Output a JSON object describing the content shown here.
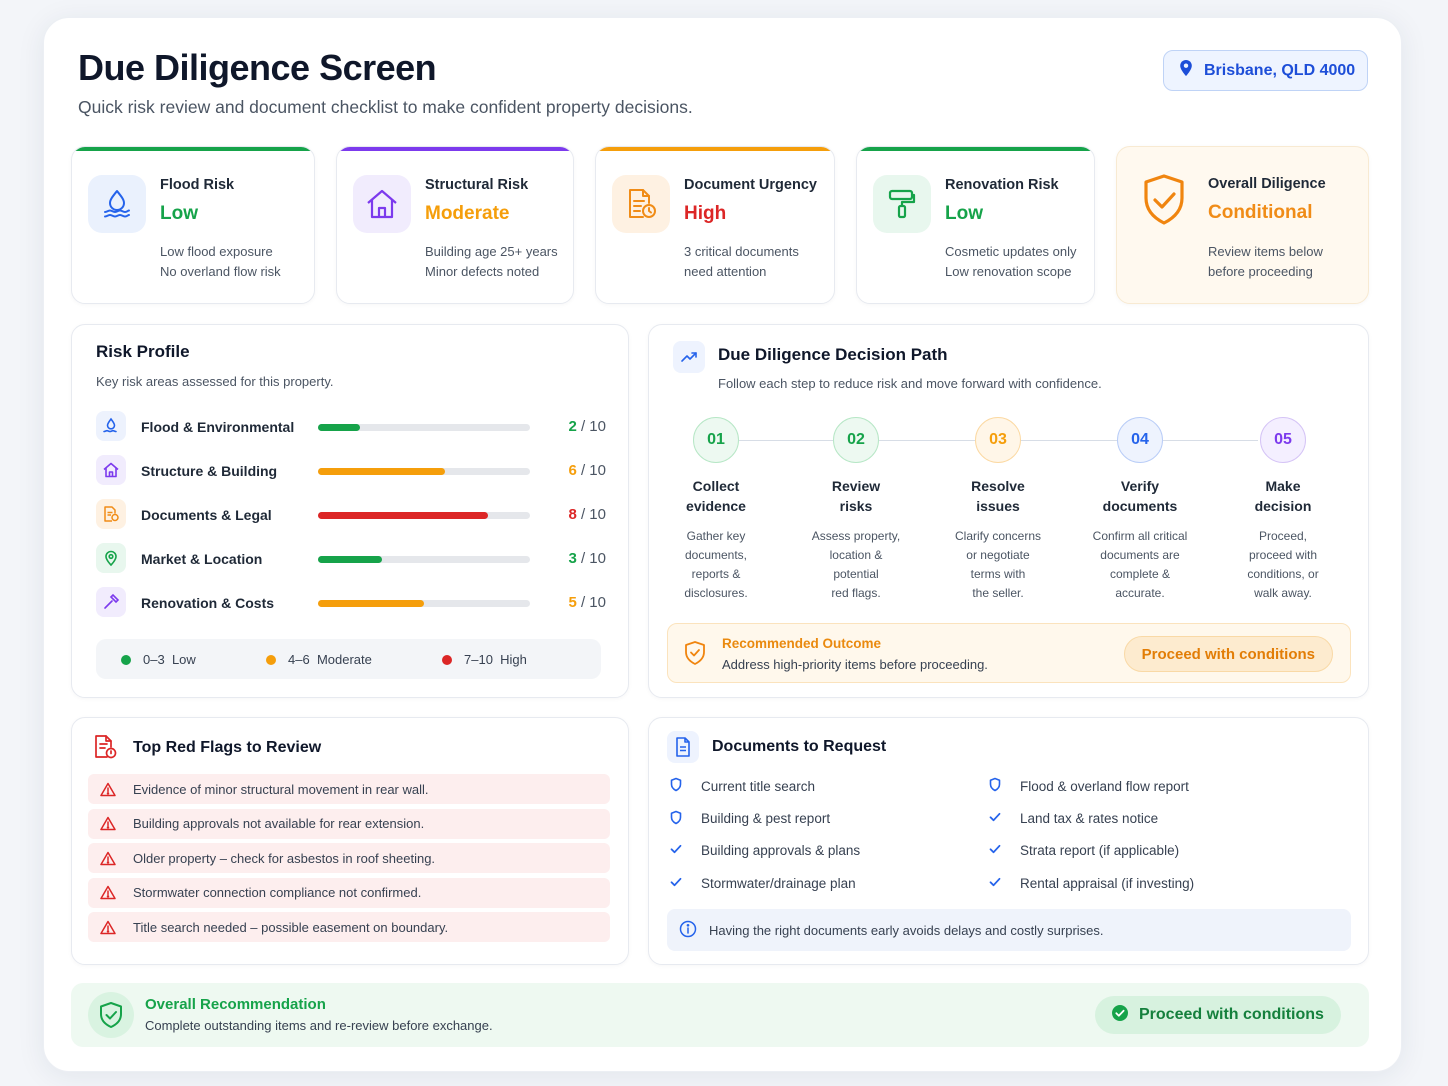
{
  "header": {
    "title": "Due Diligence Screen",
    "subtitle": "Quick risk review and document checklist to make confident property decisions.",
    "location": "Brisbane, QLD 4000"
  },
  "risk_cards": [
    {
      "label": "Flood Risk",
      "value": "Low",
      "d1": "Low flood exposure",
      "d2": "No overland flow risk",
      "color": "#16a34a",
      "icon": "water-drop-icon"
    },
    {
      "label": "Structural Risk",
      "value": "Moderate",
      "d1": "Building age 25+ years",
      "d2": "Minor defects noted",
      "color": "#f59e0b",
      "icon": "house-icon"
    },
    {
      "label": "Document Urgency",
      "value": "High",
      "d1": "3 critical documents",
      "d2": "need attention",
      "color": "#dc2626",
      "icon": "document-clock-icon"
    },
    {
      "label": "Renovation Risk",
      "value": "Low",
      "d1": "Cosmetic updates only",
      "d2": "Low renovation scope",
      "color": "#16a34a",
      "icon": "paint-roller-icon"
    },
    {
      "label": "Overall Diligence",
      "value": "Conditional",
      "d1": "Review items below",
      "d2": "before proceeding",
      "color": "#f59e0b",
      "icon": "shield-check-icon"
    }
  ],
  "risk_profile": {
    "title": "Risk Profile",
    "subtitle": "Key risk areas assessed for this property.",
    "rows": [
      {
        "label": "Flood & Environmental",
        "score": "2",
        "max": "/ 10",
        "level": 0.2,
        "color": "#16a34a",
        "icon": "water-drop-icon"
      },
      {
        "label": "Structure & Building",
        "score": "6",
        "max": "/ 10",
        "level": 0.6,
        "color": "#f59e0b",
        "icon": "house-icon"
      },
      {
        "label": "Documents & Legal",
        "score": "8",
        "max": "/ 10",
        "level": 0.8,
        "color": "#dc2626",
        "icon": "document-clock-icon"
      },
      {
        "label": "Market & Location",
        "score": "3",
        "max": "/ 10",
        "level": 0.3,
        "color": "#16a34a",
        "icon": "map-pin-icon"
      },
      {
        "label": "Renovation & Costs",
        "score": "5",
        "max": "/ 10",
        "level": 0.5,
        "color": "#f59e0b",
        "icon": "hammer-icon"
      }
    ],
    "legend": [
      {
        "range": "0–3",
        "label": "Low",
        "color": "#16a34a"
      },
      {
        "range": "4–6",
        "label": "Moderate",
        "color": "#f59e0b"
      },
      {
        "range": "7–10",
        "label": "High",
        "color": "#dc2626"
      }
    ]
  },
  "decision_path": {
    "title": "Due Diligence Decision Path",
    "subtitle": "Follow each step to reduce risk and move forward with confidence.",
    "steps": [
      {
        "num": "01",
        "t1": "Collect",
        "t2": "evidence",
        "desc": [
          "Gather key",
          "documents,",
          "reports &",
          "disclosures."
        ],
        "color": "#16a34a",
        "bg": "#edf9f1",
        "border": "#b7e7c6"
      },
      {
        "num": "02",
        "t1": "Review",
        "t2": "risks",
        "desc": [
          "Assess property,",
          "location &",
          "potential",
          "red flags."
        ],
        "color": "#16a34a",
        "bg": "#edf9f1",
        "border": "#b7e7c6"
      },
      {
        "num": "03",
        "t1": "Resolve",
        "t2": "issues",
        "desc": [
          "Clarify concerns",
          "or negotiate",
          "terms with",
          "the seller."
        ],
        "color": "#f59e0b",
        "bg": "#fff6e8",
        "border": "#fbd9a3"
      },
      {
        "num": "04",
        "t1": "Verify",
        "t2": "documents",
        "desc": [
          "Confirm all critical",
          "documents are",
          "complete &",
          "accurate."
        ],
        "color": "#2563eb",
        "bg": "#eef3fe",
        "border": "#b9cdf7"
      },
      {
        "num": "05",
        "t1": "Make",
        "t2": "decision",
        "desc": [
          "Proceed,",
          "proceed with",
          "conditions, or",
          "walk away."
        ],
        "color": "#7c3aed",
        "bg": "#f4efff",
        "border": "#d5c4f6"
      }
    ],
    "outcome": {
      "title": "Recommended Outcome",
      "desc": "Address high-priority items before proceeding.",
      "button": "Proceed with conditions"
    }
  },
  "red_flags": {
    "title": "Top Red Flags to Review",
    "items": [
      "Evidence of minor structural movement in rear wall.",
      "Building approvals not available for rear extension.",
      "Older property – check for asbestos in roof sheeting.",
      "Stormwater connection compliance not confirmed.",
      "Title search needed – possible easement on boundary."
    ]
  },
  "documents": {
    "title": "Documents to Request",
    "left": [
      {
        "label": "Current title search",
        "state": "pending"
      },
      {
        "label": "Building & pest report",
        "state": "pending"
      },
      {
        "label": "Building approvals & plans",
        "state": "done"
      },
      {
        "label": "Stormwater/drainage plan",
        "state": "done"
      }
    ],
    "right": [
      {
        "label": "Flood & overland flow report",
        "state": "pending"
      },
      {
        "label": "Land tax & rates notice",
        "state": "done"
      },
      {
        "label": "Strata report (if applicable)",
        "state": "done"
      },
      {
        "label": "Rental appraisal (if investing)",
        "state": "done"
      }
    ],
    "tip": "Having the right documents early avoids delays and costly surprises."
  },
  "overall": {
    "title": "Overall Recommendation",
    "desc": "Complete outstanding items and re-review before exchange.",
    "button": "Proceed with conditions"
  }
}
